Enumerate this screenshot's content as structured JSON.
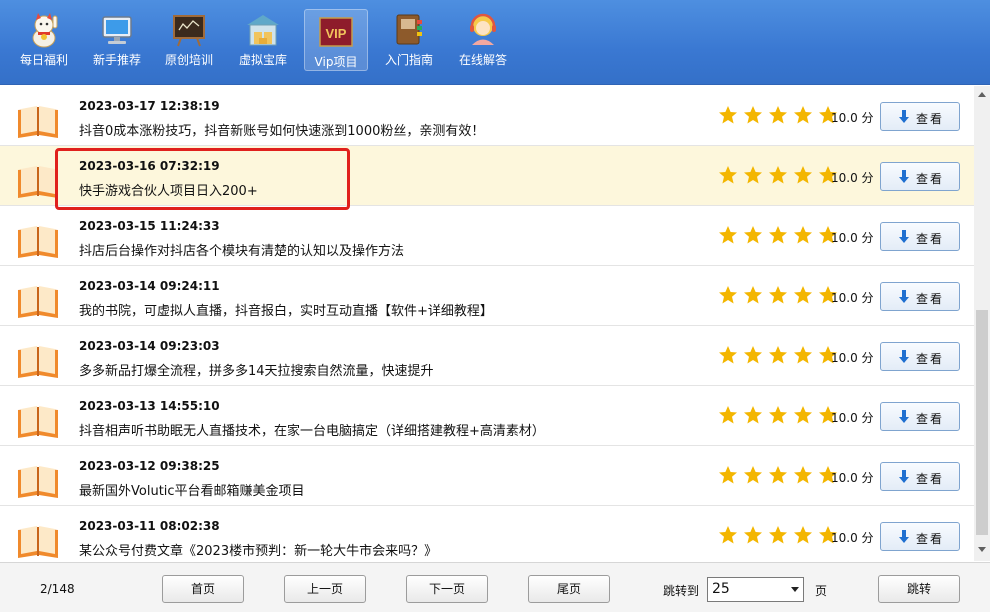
{
  "toolbar": {
    "items": [
      {
        "label": "每日福利",
        "icon": "lucky-cat-icon"
      },
      {
        "label": "新手推荐",
        "icon": "monitor-icon"
      },
      {
        "label": "原创培训",
        "icon": "blackboard-icon"
      },
      {
        "label": "虚拟宝库",
        "icon": "warehouse-icon"
      },
      {
        "label": "Vip项目",
        "icon": "vip-icon",
        "icon_text": "VIP",
        "active": true
      },
      {
        "label": "入门指南",
        "icon": "book-guide-icon"
      },
      {
        "label": "在线解答",
        "icon": "support-agent-icon"
      }
    ]
  },
  "colors": {
    "toolbar_bg": "#3a78d2",
    "selected_row_bg": "#fdf7dc",
    "highlight_border": "#e0201c",
    "star": "#f3b600",
    "download_arrow": "#1f6fd0"
  },
  "list": {
    "view_label": "查看",
    "rows": [
      {
        "date": "2023-03-17 12:38:19",
        "title": "抖音0成本涨粉技巧，抖音新账号如何快速涨到1000粉丝，亲测有效！",
        "rating_stars": 5,
        "score": "10.0 分"
      },
      {
        "date": "2023-03-16 07:32:19",
        "title": "快手游戏合伙人项目日入200+",
        "rating_stars": 5,
        "score": "10.0 分",
        "selected": true
      },
      {
        "date": "2023-03-15 11:24:33",
        "title": "抖店后台操作对抖店各个模块有清楚的认知以及操作方法",
        "rating_stars": 5,
        "score": "10.0 分"
      },
      {
        "date": "2023-03-14 09:24:11",
        "title": "我的书院，可虚拟人直播，抖音报白，实时互动直播【软件+详细教程】",
        "rating_stars": 5,
        "score": "10.0 分"
      },
      {
        "date": "2023-03-14 09:23:03",
        "title": "多多新品打爆全流程，拼多多14天拉搜索自然流量，快速提升",
        "rating_stars": 5,
        "score": "10.0 分"
      },
      {
        "date": "2023-03-13 14:55:10",
        "title": "抖音相声听书助眠无人直播技术，在家一台电脑搞定（详细搭建教程+高清素材）",
        "rating_stars": 5,
        "score": "10.0 分"
      },
      {
        "date": "2023-03-12 09:38:25",
        "title": "最新国外Volutic平台看邮箱赚美金项目",
        "rating_stars": 5,
        "score": "10.0 分"
      },
      {
        "date": "2023-03-11 08:02:38",
        "title": "某公众号付费文章《2023楼市预判：新一轮大牛市会来吗？》",
        "rating_stars": 5,
        "score": "10.0 分"
      }
    ]
  },
  "footer": {
    "page_info": "2/148",
    "first_label": "首页",
    "prev_label": "上一页",
    "next_label": "下一页",
    "last_label": "尾页",
    "jump_label": "跳转到",
    "jump_value": "25",
    "page_unit": "页",
    "go_label": "跳转"
  }
}
